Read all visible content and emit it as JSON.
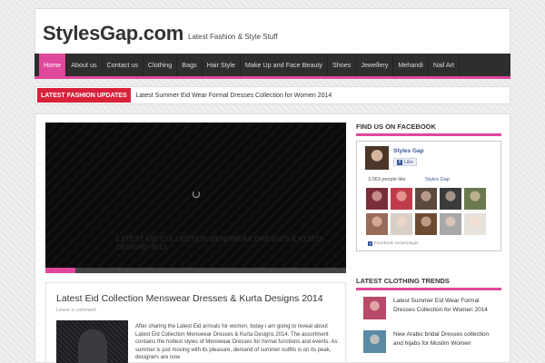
{
  "header": {
    "logo": "StylesGap.com",
    "tagline": "Latest Fashion & Style Stuff"
  },
  "nav": {
    "items": [
      {
        "label": "Home",
        "active": true
      },
      {
        "label": "About us"
      },
      {
        "label": "Contact us"
      },
      {
        "label": "Clothing"
      },
      {
        "label": "Bags"
      },
      {
        "label": "Hair Style"
      },
      {
        "label": "Make Up and Face Beauty"
      },
      {
        "label": "Shoes"
      },
      {
        "label": "Jewellery"
      },
      {
        "label": "Mehandi"
      },
      {
        "label": "Nail Art"
      }
    ]
  },
  "ticker": {
    "label": "LATEST FASHION UPDATES",
    "text": "Latest Summer Eid Wear Formal Dresses Collection for Women 2014"
  },
  "slider": {
    "caption": "LATEST EID COLLECTION MENSWEAR DRESSES & KURTA DESIGNS 2014",
    "progress_percent": 10
  },
  "post": {
    "title": "Latest Eid Collection Menswear Dresses & Kurta Designs 2014",
    "meta": "Leave a comment",
    "excerpt": "After sharing the Latest Eid arrivals for women, today i am going to reveal about Latest Eid Collection Menswear Dresses & Kurta Designs 2014. The assortment contains the hottest styles of Menswear Dresses for formal functions and events. As summer is just moving with its pleasure, demand of summer outfits is on its peak, designers are now"
  },
  "facebook_widget": {
    "title": "FIND US ON FACEBOOK",
    "page_name": "Styles Gap",
    "like_label": "Like",
    "people_like": "3,063 people like",
    "page_link": "Styles Gap",
    "plugin_text": "Facebook social plugin",
    "face_colors": [
      "#7a2e3a",
      "#c23b4a",
      "#5c4a3e",
      "#3b3b3b",
      "#6b7a4e",
      "#9a6b5a",
      "#d8cfc6",
      "#6f4a33",
      "#a8a8a8",
      "#e8e2dc"
    ]
  },
  "trends_widget": {
    "title": "LATEST CLOTHING TRENDS",
    "items": [
      {
        "text": "Latest Summer Eid Wear Formal Dresses Collection for Women 2014",
        "thumb_color": "#b84a6a"
      },
      {
        "text": "New Arabic bridal Dresses collection and hijabs for Muslim Women",
        "thumb_color": "#5a8aa6"
      }
    ]
  },
  "colors": {
    "accent": "#e0489b",
    "ticker_red": "#d8213a",
    "nav_bg": "#2e2e2e"
  }
}
